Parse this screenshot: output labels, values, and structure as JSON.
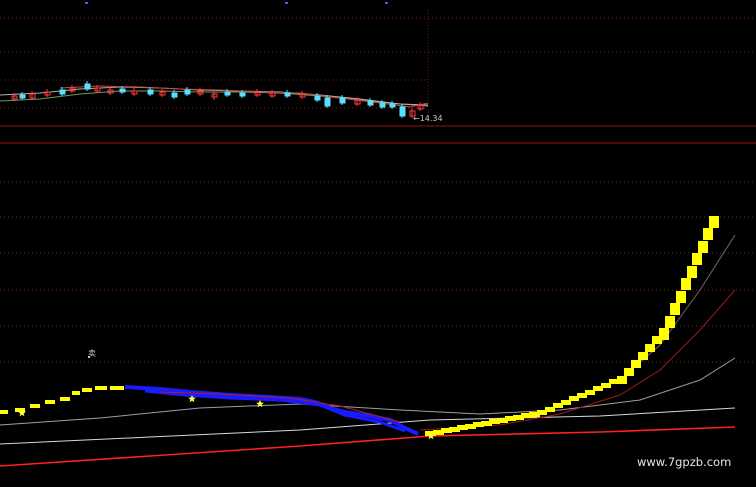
{
  "watermark": "www.7gpzb.com",
  "price_panel": {
    "low_marker": "←14.34"
  },
  "indicator_panel": {
    "signal_label": "卖"
  },
  "colors": {
    "background": "#000000",
    "grid_red": "#8b1a1a",
    "candle_up": "#ff3b3b",
    "candle_down": "#5ae0ff",
    "yellow_band": "#ffff00",
    "blue_band": "#1a1aff",
    "long_line_red": "#ff2020",
    "white_line": "#d8d8d8",
    "grey_line": "#9aa0a0",
    "star": "#ffff40"
  },
  "icons": [
    "star-icon",
    "sell-signal-marker"
  ]
}
